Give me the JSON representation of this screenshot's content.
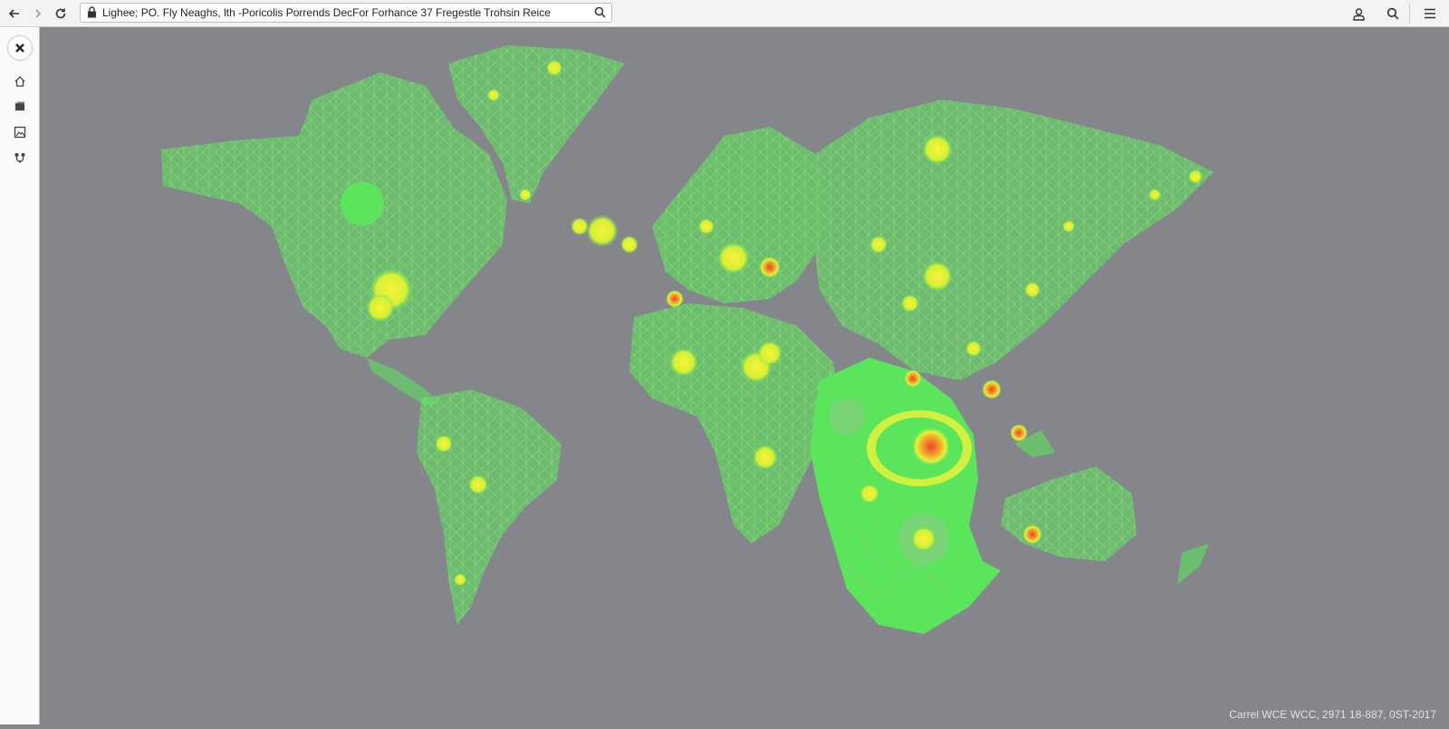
{
  "browser": {
    "address_text": "Lighee; PO. Fly Neaghs, lth -Poricolis Porrends DecFor Forhance 37 Fregestle Trohsin Reice",
    "back_icon": "arrow-left-icon",
    "forward_icon": "arrow-right-icon",
    "reload_icon": "reload-icon",
    "lock_icon": "lock-icon",
    "search_icon": "search-icon",
    "profile_icon": "user-icon",
    "find_icon": "search-icon",
    "menu_icon": "hamburger-menu-icon"
  },
  "sidebar": {
    "close_icon": "close-icon",
    "items": [
      {
        "icon": "home-icon"
      },
      {
        "icon": "layers-icon"
      },
      {
        "icon": "image-icon"
      },
      {
        "icon": "share-icon"
      }
    ]
  },
  "map": {
    "background": "#85868b",
    "land_color": "#5be55c",
    "hotspot_color": "#e6f23a",
    "peak_color": "#e8452a"
  },
  "footer": {
    "credit": "Carrel WCE WCC, 2971 18-887, 0ST-2017"
  }
}
